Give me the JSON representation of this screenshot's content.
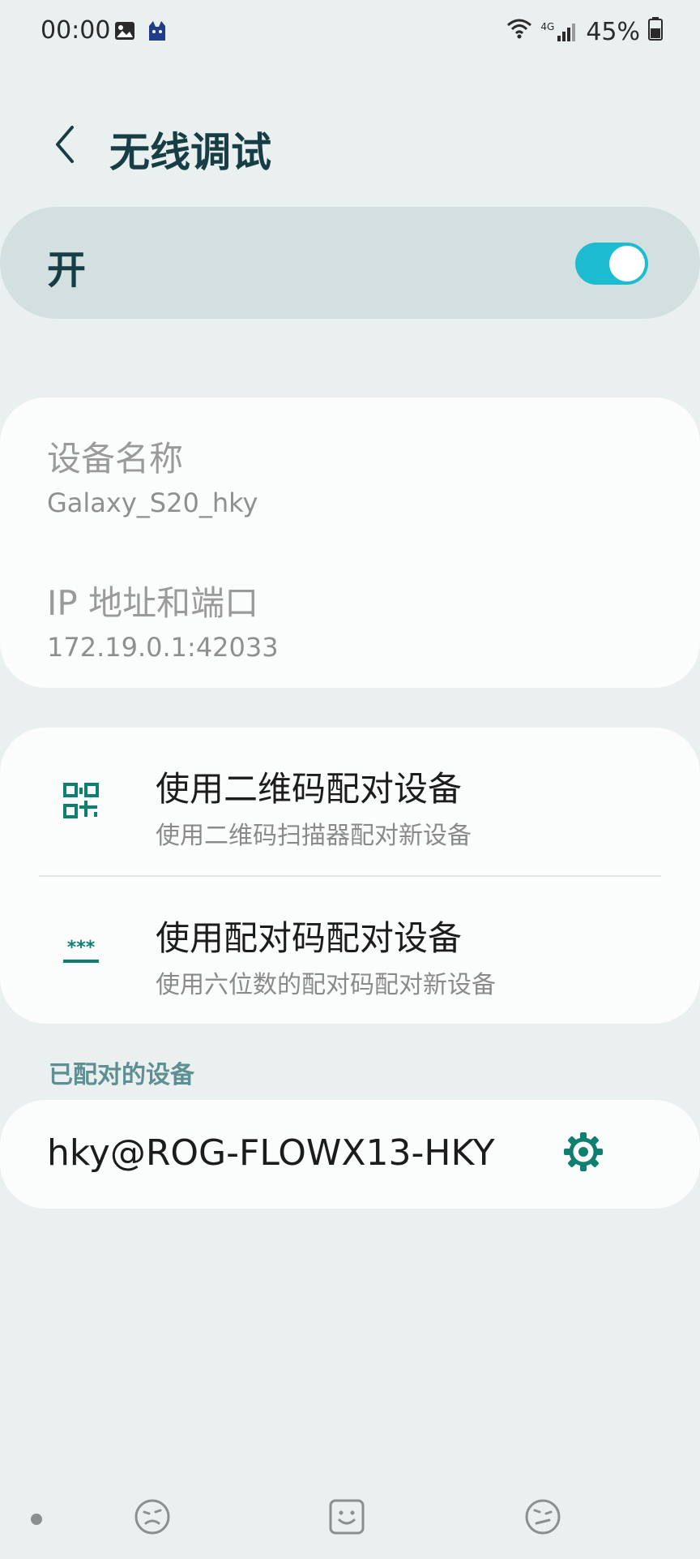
{
  "status_bar": {
    "time": "00:00",
    "battery_percent": "45%",
    "network": "4G",
    "icons": [
      "gallery-icon",
      "app-cat-icon",
      "wifi-icon",
      "signal-icon",
      "battery-icon"
    ]
  },
  "header": {
    "title": "无线调试",
    "back_icon": "back-arrow-icon"
  },
  "master_switch": {
    "label": "开",
    "on": true,
    "accent_color": "#1ebcd0"
  },
  "info": {
    "device_name_title": "设备名称",
    "device_name_value": "Galaxy_S20_hky",
    "ip_title": "IP 地址和端口",
    "ip_value": "172.19.0.1:42033"
  },
  "pairing": {
    "qr": {
      "title": "使用二维码配对设备",
      "subtitle": "使用二维码扫描器配对新设备",
      "icon": "qr-code-icon"
    },
    "code": {
      "title": "使用配对码配对设备",
      "subtitle": "使用六位数的配对码配对新设备",
      "icon": "pairing-code-icon"
    }
  },
  "paired_devices": {
    "header": "已配对的设备",
    "items": [
      {
        "name": "hky@ROG-FLOWX13-HKY",
        "icon": "gear-icon"
      }
    ]
  },
  "colors": {
    "background": "#eaf0f0",
    "card": "#fbfcfc",
    "title_text": "#163e44",
    "icon_teal": "#0f7f6f"
  }
}
